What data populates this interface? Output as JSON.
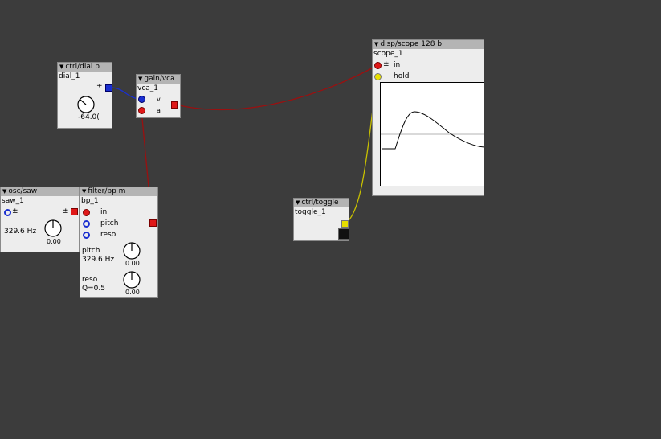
{
  "objects": {
    "dial": {
      "type": "ctrl/dial b",
      "name": "dial_1",
      "pm": "±",
      "value": "-64.0("
    },
    "vca": {
      "type": "gain/vca",
      "name": "vca_1",
      "in_v": "v",
      "in_a": "a"
    },
    "scope": {
      "type": "disp/scope 128 b",
      "name": "scope_1",
      "pm": "±",
      "in": "in",
      "hold": "hold"
    },
    "saw": {
      "type": "osc/saw",
      "name": "saw_1",
      "pm_left": "±",
      "pm_right": "±",
      "freq": "329.6 Hz",
      "dial_value": "0.00"
    },
    "filter": {
      "type": "filter/bp m",
      "name": "bp_1",
      "in": "in",
      "in_pitch": "pitch",
      "in_reso": "reso",
      "param_pitch": "pitch",
      "pitch_value": "329.6 Hz",
      "pitch_dial": "0.00",
      "param_reso": "reso",
      "reso_value": "Q=0.5",
      "reso_dial": "0.00"
    },
    "toggle": {
      "type": "ctrl/toggle",
      "name": "toggle_1"
    }
  },
  "colors": {
    "canvas": "#3c3c3c",
    "audio_wire": "#8a1010",
    "control_wire": "#1a2fd0",
    "bool_wire": "#c8c000"
  }
}
